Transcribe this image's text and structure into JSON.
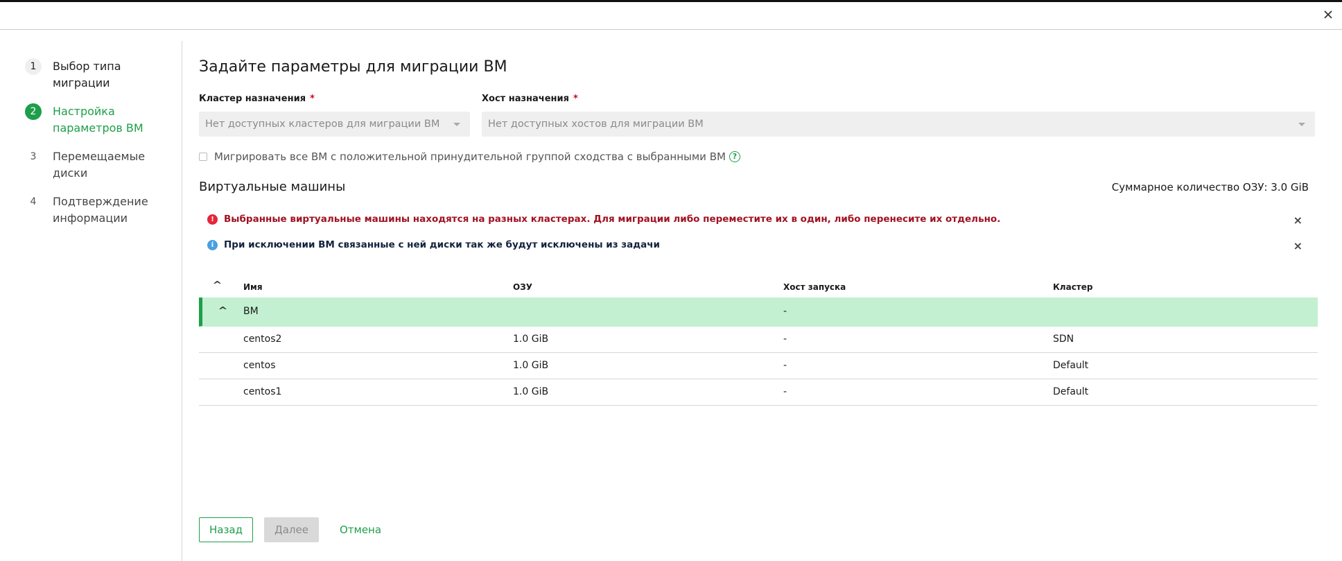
{
  "window": {
    "close_icon": "close-icon"
  },
  "steps": [
    {
      "num": "1",
      "label": "Выбор типа миграции",
      "state": "done"
    },
    {
      "num": "2",
      "label": "Настройка параметров ВМ",
      "state": "active"
    },
    {
      "num": "3",
      "label": "Перемещаемые диски",
      "state": "pending"
    },
    {
      "num": "4",
      "label": "Подтверждение информации",
      "state": "pending"
    }
  ],
  "main": {
    "title": "Задайте параметры для миграции ВМ",
    "cluster": {
      "label": "Кластер назначения",
      "required_mark": "*",
      "placeholder": "Нет доступных кластеров для миграции ВМ"
    },
    "host": {
      "label": "Хост назначения",
      "required_mark": "*",
      "placeholder": "Нет доступных хостов для миграции ВМ"
    },
    "affinity_checkbox": {
      "label": "Мигрировать все ВМ с положительной принудительной группой сходства с выбранными ВМ",
      "checked": false,
      "help_icon": "question-circle-icon",
      "help_glyph": "?"
    },
    "vm_section": {
      "title": "Виртуальные машины",
      "ram_total": "Суммарное количество ОЗУ: 3.0 GiB"
    },
    "alerts": [
      {
        "type": "error",
        "icon": "error-circle-icon",
        "glyph": "!",
        "text": "Выбранные виртуальные машины находятся на разных кластерах. Для миграции либо переместите их в один, либо перенесите их отдельно.",
        "close": "×"
      },
      {
        "type": "info",
        "icon": "info-circle-icon",
        "glyph": "i",
        "text": "При исключении ВМ связанные с ней диски так же будут исключены из задачи",
        "close": "×"
      }
    ],
    "table": {
      "collapse_glyph": "^",
      "columns": [
        "Имя",
        "ОЗУ",
        "Хост запуска",
        "Кластер"
      ],
      "group": {
        "name": "ВМ",
        "ram": "",
        "host": "-",
        "cluster": ""
      },
      "rows": [
        {
          "name": "centos2",
          "ram": "1.0 GiB",
          "host": "-",
          "cluster": "SDN"
        },
        {
          "name": "centos",
          "ram": "1.0 GiB",
          "host": "-",
          "cluster": "Default"
        },
        {
          "name": "centos1",
          "ram": "1.0 GiB",
          "host": "-",
          "cluster": "Default"
        }
      ]
    }
  },
  "footer": {
    "back": "Назад",
    "next": "Далее",
    "cancel": "Отмена"
  },
  "colors": {
    "accent": "#1e9e4a",
    "error": "#e5263a",
    "info": "#4a9fe0",
    "group_row_bg": "#c3f0d1"
  }
}
